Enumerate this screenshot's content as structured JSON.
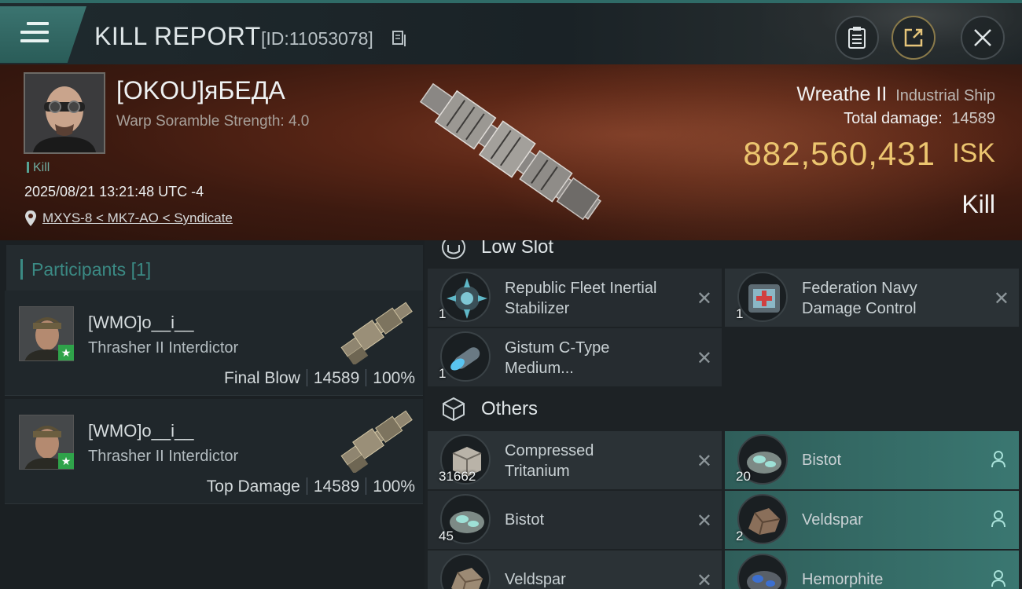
{
  "header": {
    "title": "KILL REPORT",
    "report_id": "[ID:11053078]"
  },
  "victim": {
    "name": "[OKOU]яБЕДА",
    "subtitle": "Warp Soramble Strength: 4.0",
    "tag": "Kill",
    "timestamp": "2025/08/21 13:21:48 UTC -4",
    "location": "MXYS-8 < MK7-AO < Syndicate"
  },
  "ship": {
    "name": "Wreathe II",
    "class": "Industrial Ship",
    "total_damage_label": "Total damage:",
    "total_damage": "14589",
    "value": "882,560,431",
    "value_unit": "ISK",
    "result": "Kill"
  },
  "participants": {
    "title": "Participants",
    "count": "[1]",
    "rows": [
      {
        "name": "[WMO]o__i__",
        "ship": "Thrasher II Interdictor",
        "role": "Final Blow",
        "damage": "14589",
        "percent": "100%"
      },
      {
        "name": "[WMO]o__i__",
        "ship": "Thrasher II Interdictor",
        "role": "Top Damage",
        "damage": "14589",
        "percent": "100%"
      }
    ]
  },
  "sections": {
    "low_slot": "Low Slot",
    "others": "Others"
  },
  "low_slot_items": [
    {
      "line1": "Republic Fleet Inertial",
      "line2": "Stabilizer",
      "qty": "1"
    },
    {
      "line1": "Federation Navy",
      "line2": "Damage Control",
      "qty": "1"
    },
    {
      "line1": "Gistum C-Type",
      "line2": "Medium...",
      "qty": "1"
    }
  ],
  "other_items": [
    {
      "line1": "Compressed",
      "line2": "Tritanium",
      "qty": "31662"
    },
    {
      "line1": "Bistot",
      "qty": "20"
    },
    {
      "line1": "Bistot",
      "qty": "45"
    },
    {
      "line1": "Veldspar",
      "qty": "2"
    },
    {
      "line1": "Veldspar",
      "qty": ""
    },
    {
      "line1": "Hemorphite",
      "qty": ""
    }
  ],
  "colors": {
    "accent": "#3b8a84",
    "isk": "#ecc56f",
    "dropped_highlight": "#3a7771"
  },
  "icons": [
    "menu-icon",
    "clipboard-icon",
    "share-icon",
    "close-icon",
    "copy-icon",
    "location-pin-icon",
    "shield-slot-icon",
    "cube-icon",
    "close-x-icon",
    "user-icon"
  ]
}
